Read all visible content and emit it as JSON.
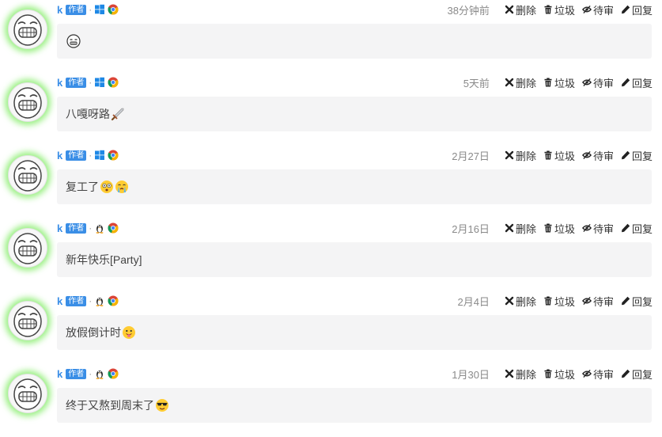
{
  "labels": {
    "badge": "作者",
    "sep": "·"
  },
  "actions": {
    "delete": "删除",
    "trash": "垃圾",
    "pending": "待审",
    "reply": "回复"
  },
  "colors": {
    "author": "#3a8ee6",
    "avatar_glow": "#78eb5a",
    "bubble_bg": "#f4f4f5"
  },
  "comments": [
    {
      "author": "k",
      "os_icon": "windows-icon",
      "browser_icon": "chrome-icon",
      "time": "38分钟前",
      "text": "",
      "emojis": [
        "grimace-emoji"
      ]
    },
    {
      "author": "k",
      "os_icon": "windows-icon",
      "browser_icon": "chrome-icon",
      "time": "5天前",
      "text": "八嘎呀路",
      "emojis": [
        "sword-emoji"
      ]
    },
    {
      "author": "k",
      "os_icon": "windows-icon",
      "browser_icon": "chrome-icon",
      "time": "2月27日",
      "text": "复工了",
      "emojis": [
        "dizzy-face-emoji",
        "crying-emoji"
      ]
    },
    {
      "author": "k",
      "os_icon": "linux-icon",
      "browser_icon": "chrome-icon",
      "time": "2月16日",
      "text": "新年快乐[Party]",
      "emojis": []
    },
    {
      "author": "k",
      "os_icon": "linux-icon",
      "browser_icon": "chrome-icon",
      "time": "2月4日",
      "text": "放假倒计时",
      "emojis": [
        "tongue-face-emoji"
      ]
    },
    {
      "author": "k",
      "os_icon": "linux-icon",
      "browser_icon": "chrome-icon",
      "time": "1月30日",
      "text": "终于又熬到周末了",
      "emojis": [
        "sunglasses-emoji"
      ]
    }
  ]
}
